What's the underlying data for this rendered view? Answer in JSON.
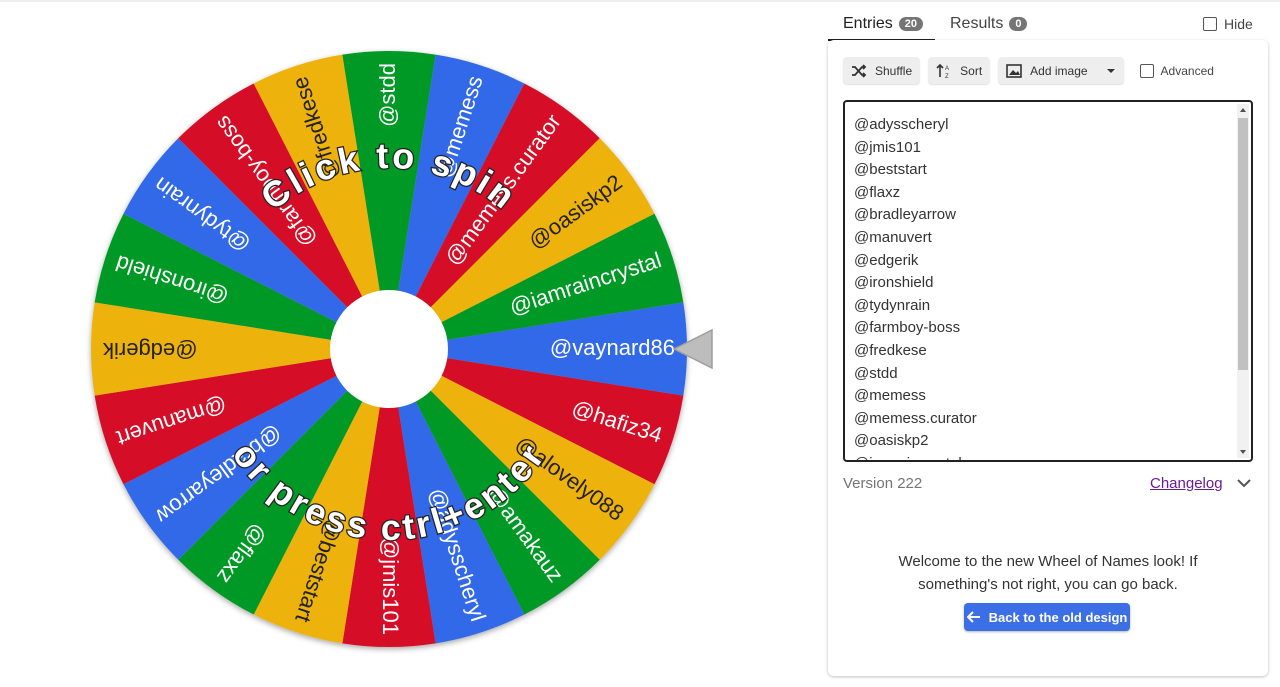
{
  "tabs": {
    "entries_label": "Entries",
    "entries_count": "20",
    "results_label": "Results",
    "results_count": "0"
  },
  "hide_label": "Hide",
  "toolbar": {
    "shuffle_label": "Shuffle",
    "sort_label": "Sort",
    "add_image_label": "Add image",
    "advanced_label": "Advanced"
  },
  "entries": [
    "@adysscheryl",
    "@jmis101",
    "@beststart",
    "@flaxz",
    "@bradleyarrow",
    "@manuvert",
    "@edgerik",
    "@ironshield",
    "@tydynrain",
    "@farmboy-boss",
    "@fredkese",
    "@stdd",
    "@memess",
    "@memess.curator",
    "@oasiskp2",
    "@iamraincrystal"
  ],
  "version": "Version 222",
  "changelog_label": "Changelog",
  "welcome": {
    "line1": "Welcome to the new Wheel of Names look! If",
    "line2": "something's not right, you can go back."
  },
  "back_button_label": "Back to the old design",
  "wheel": {
    "click_text": "Click to spin",
    "press_text": "or press ctrl+enter",
    "colors": [
      "#3369e8",
      "#d50f25",
      "#eeb211",
      "#009925"
    ],
    "slices": [
      "@vaynard86",
      "@hafiz34",
      "@alovely088",
      "@amakauz",
      "@adysscheryl",
      "@jmis101",
      "@beststart",
      "@flaxz",
      "@bradleyarrow",
      "@manuvert",
      "@edgerik",
      "@ironshield",
      "@tydynrain",
      "@farmboy-boss",
      "@fredkese",
      "@stdd",
      "@memess",
      "@memess.curator",
      "@oasiskp2",
      "@iamraincrystal"
    ]
  }
}
